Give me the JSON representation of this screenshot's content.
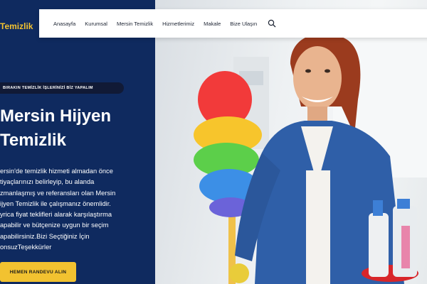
{
  "brand": {
    "logo_text": "Temizlik"
  },
  "nav": {
    "items": [
      "Anasayfa",
      "Kurumsal",
      "Mersin Temizlik",
      "Hizmetlerimiz",
      "Makale",
      "Bize Ulaşın"
    ],
    "extra": "",
    "search_icon": "search-icon"
  },
  "hero": {
    "badge": "BIRAKIN TEMİZLİK İŞLERİNİZİ BİZ YAPALIM",
    "headline": "Mersin Hijyen\nTemizlik",
    "paragraph": "ersin'de temizlik hizmeti almadan önce\ntiyaçlarınızı belirleyip, bu alanda\nzmanlaşmış ve referansları olan Mersin\nijyen Temizlik ile çalışmanız önemlidir.\nyrica fiyat teklifleri alarak karşılaştırma\napabilir ve bütçenize uygun bir seçim\napabilirsiniz.Bizi Seçtiğiniz İçin\nonsuzTeşekkürler",
    "cta_label": "HEMEN RANDEVU ALIN"
  },
  "colors": {
    "panel": "#0f2a5f",
    "accent": "#f2c230",
    "badge_bg": "#111a36"
  }
}
